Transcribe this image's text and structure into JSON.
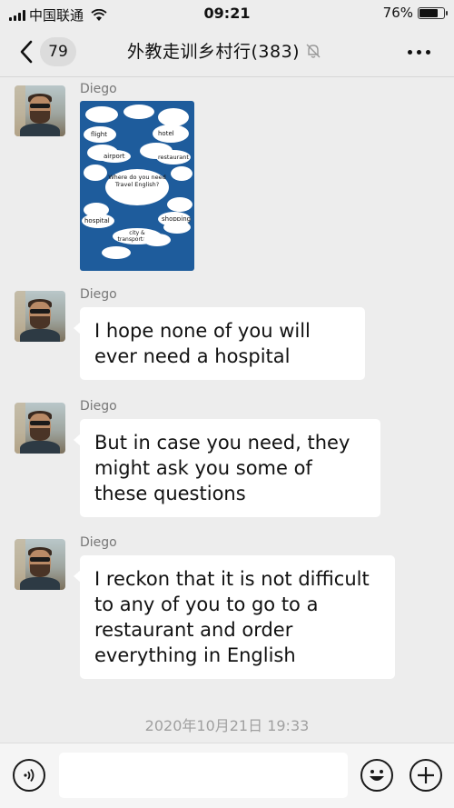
{
  "status_bar": {
    "carrier": "中国联通",
    "time": "09:21",
    "battery_percent": "76%",
    "battery_level": 0.76
  },
  "nav": {
    "unread_count": "79",
    "title": "外教走训乡村行(383)",
    "icons": [
      "back-chevron-icon",
      "mute-bell-icon",
      "more-icon"
    ]
  },
  "messages": [
    {
      "sender": "Diego",
      "type": "image",
      "poster": {
        "center_text": "Where do you need Travel English?",
        "labels": [
          "flight",
          "hotel",
          "airport",
          "restaurant",
          "hospital",
          "shopping",
          "city & transportation"
        ]
      }
    },
    {
      "sender": "Diego",
      "type": "text",
      "text": "I hope none of you will ever need a hospital"
    },
    {
      "sender": "Diego",
      "type": "text",
      "text": "But in case you need, they might ask you some of these questions"
    },
    {
      "sender": "Diego",
      "type": "text",
      "text": "I reckon that it is not difficult to any of you to go to a restaurant and order everything in English"
    }
  ],
  "timestamp": "2020年10月21日 19:33",
  "input_bar": {
    "placeholder": "",
    "icons": [
      "voice-icon",
      "emoji-icon",
      "plus-icon"
    ]
  }
}
